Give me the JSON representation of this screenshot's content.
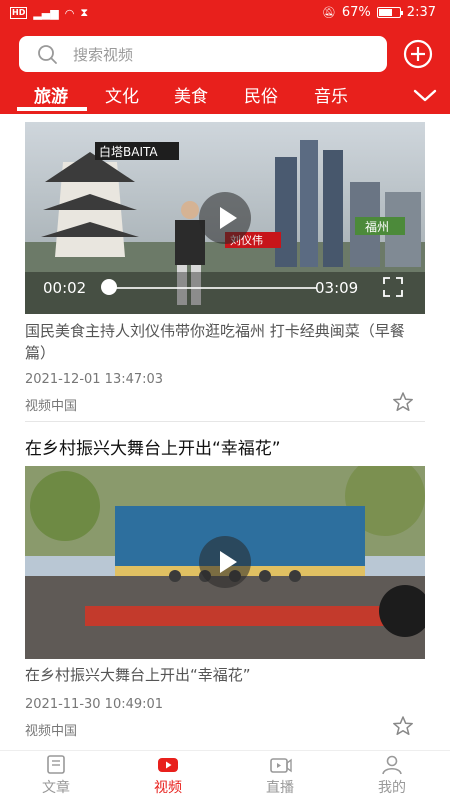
{
  "status_bar": {
    "network": "HD",
    "battery_level": "67%",
    "time": "2:37"
  },
  "search": {
    "placeholder": "搜索视频"
  },
  "tabs": [
    {
      "label": "旅游",
      "active": true
    },
    {
      "label": "文化",
      "active": false
    },
    {
      "label": "美食",
      "active": false
    },
    {
      "label": "民俗",
      "active": false
    },
    {
      "label": "音乐",
      "active": false
    }
  ],
  "feed": [
    {
      "overlay_text": [
        "白塔BAITA",
        "刘仪伟",
        "福州"
      ],
      "current_time": "00:02",
      "duration": "03:09",
      "progress": 0.01,
      "caption": "国民美食主持人刘仪伟带你逛吃福州 打卡经典闽菜（早餐篇）",
      "date": "2021-12-01 13:47:03",
      "source": "视频中国"
    },
    {
      "headline": "在乡村振兴大舞台上开出“幸福花”",
      "caption": "在乡村振兴大舞台上开出“幸福花”",
      "date": "2021-11-30 10:49:01",
      "source": "视频中国"
    }
  ],
  "bottom_nav": [
    {
      "label": "文章",
      "icon": "article-icon",
      "active": false
    },
    {
      "label": "视频",
      "icon": "video-icon",
      "active": true
    },
    {
      "label": "直播",
      "icon": "live-icon",
      "active": false
    },
    {
      "label": "我的",
      "icon": "profile-icon",
      "active": false
    }
  ],
  "colors": {
    "brand_red": "#e8201c",
    "inactive_gray": "#999999"
  }
}
